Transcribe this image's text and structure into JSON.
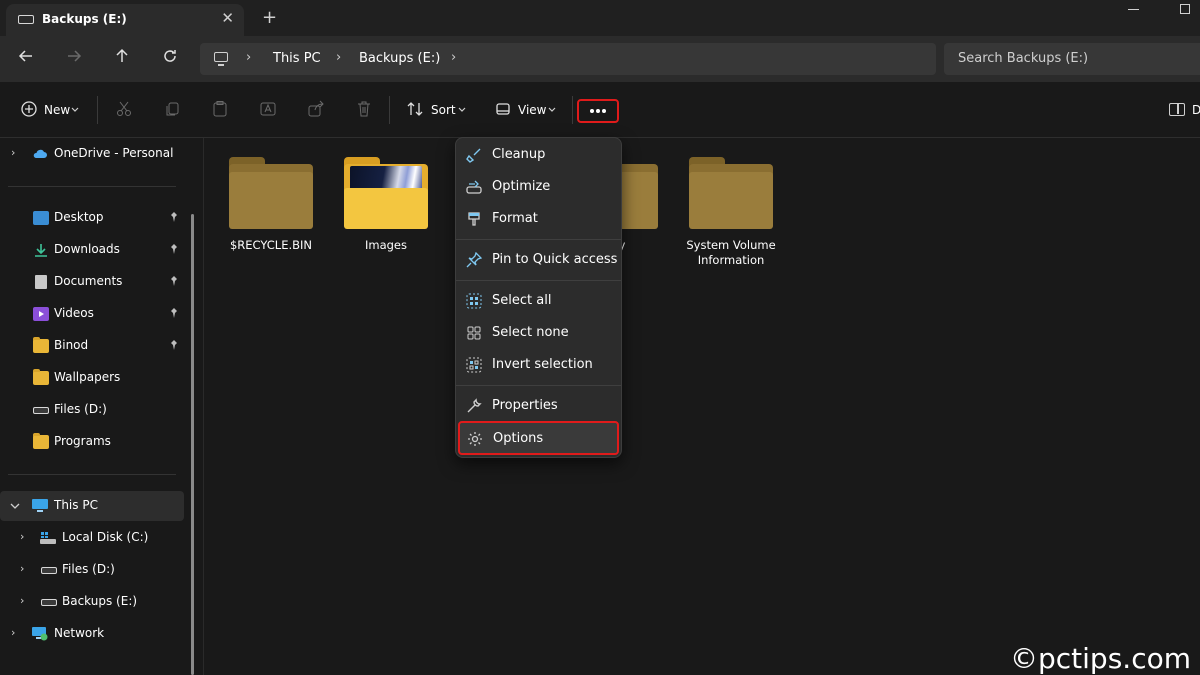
{
  "tab": {
    "title": "Backups (E:)",
    "close": "✕",
    "new_tab": "+"
  },
  "address": {
    "segments": [
      "This PC",
      "Backups (E:)"
    ],
    "separator": "›",
    "search_placeholder": "Search Backups (E:)"
  },
  "toolbar": {
    "new_label": "New",
    "sort_label": "Sort",
    "view_label": "View",
    "details_label": "D"
  },
  "sidebar": {
    "onedrive": "OneDrive - Personal",
    "quick": [
      "Desktop",
      "Downloads",
      "Documents",
      "Videos",
      "Binod",
      "Wallpapers",
      "Files (D:)",
      "Programs"
    ],
    "this_pc": "This PC",
    "drives": [
      "Local Disk (C:)",
      "Files (D:)",
      "Backups (E:)"
    ],
    "network": "Network"
  },
  "folders": [
    "$RECYCLE.BIN",
    "Images",
    "very",
    "System Volume Information"
  ],
  "menu": {
    "items": [
      "Cleanup",
      "Optimize",
      "Format",
      "Pin to Quick access",
      "Select all",
      "Select none",
      "Invert selection",
      "Properties",
      "Options"
    ]
  },
  "watermark": "©pctips.com",
  "colors": {
    "accent": "#60cdff",
    "highlight_border": "#e01b1b",
    "folder": "#e9b637"
  }
}
